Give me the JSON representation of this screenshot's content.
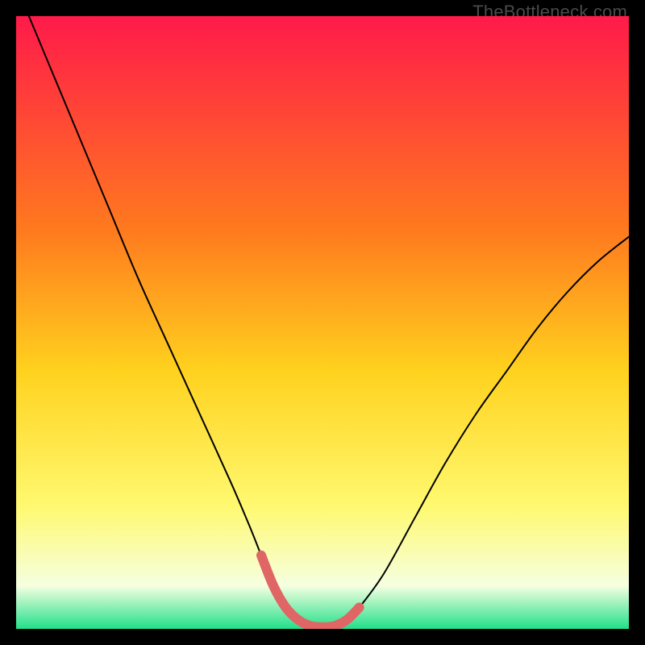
{
  "watermark": "TheBottleneck.com",
  "colors": {
    "bg_black": "#000000",
    "curve": "#000000",
    "highlight": "#e06666",
    "gradient_top": "#ff1a4a",
    "gradient_mid1": "#ff7a1e",
    "gradient_mid2": "#ffd21e",
    "gradient_mid3": "#fff970",
    "gradient_bottom_pale": "#f5ffe0",
    "gradient_bottom_green": "#22e08a"
  },
  "chart_data": {
    "type": "line",
    "title": "",
    "xlabel": "",
    "ylabel": "",
    "xlim": [
      0,
      100
    ],
    "ylim": [
      0,
      100
    ],
    "series": [
      {
        "name": "bottleneck-curve",
        "x": [
          0,
          5,
          10,
          15,
          20,
          25,
          30,
          35,
          38,
          40,
          42,
          44,
          46,
          48,
          50,
          52,
          54,
          56,
          60,
          65,
          70,
          75,
          80,
          85,
          90,
          95,
          100
        ],
        "y": [
          105,
          93,
          81,
          69,
          57,
          46,
          35,
          24,
          17,
          12,
          7,
          3.5,
          1.5,
          0.5,
          0.3,
          0.5,
          1.5,
          3.5,
          9,
          18,
          27,
          35,
          42,
          49,
          55,
          60,
          64
        ]
      }
    ],
    "highlight_segment": {
      "name": "optimal-range",
      "x": [
        40,
        42,
        44,
        46,
        48,
        50,
        52,
        54,
        56
      ],
      "y": [
        12,
        7,
        3.5,
        1.5,
        0.5,
        0.3,
        0.5,
        1.5,
        3.5
      ]
    }
  }
}
